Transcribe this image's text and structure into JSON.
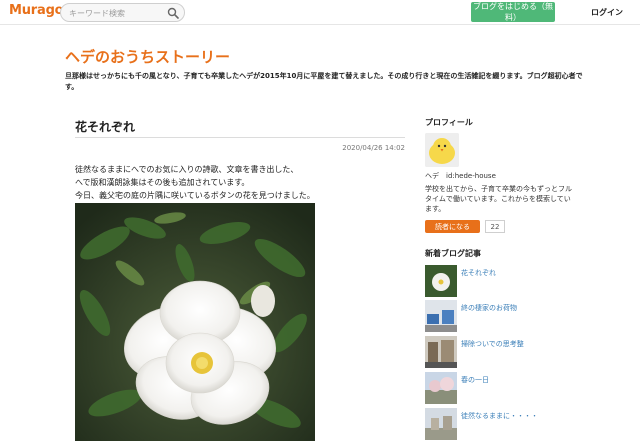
{
  "header": {
    "logo": "Muragon",
    "search_placeholder": "キーワード検索",
    "start_button": "ブログをはじめる（無料）",
    "login": "ログイン"
  },
  "blog": {
    "title": "ヘデのおうちストーリー",
    "description": "旦那様はせっかちにも千の風となり、子育ても卒業したヘデが2015年10月に平屋を建て替えました。その成り行きと現在の生活雑記を綴ります。ブログ超初心者です。"
  },
  "post": {
    "title": "花それぞれ",
    "date": "2020/04/26 14:02",
    "lines": [
      "徒然なるままにへでのお気に入りの詩歌、文章を書き出した、",
      "へで版和漢朗詠集はその後も追加されています。",
      "今日、義父宅の庭の片隅に咲いているボタンの花を見つけました。"
    ]
  },
  "sidebar": {
    "profile_heading": "プロフィール",
    "profile_name": "ヘデ　id:hede-house",
    "profile_text": "学校を出てから、子育て卒業の今もずっとフルタイムで働いています。これからを模索しています。",
    "reader_button": "読者になる",
    "reader_count": "22",
    "recent_heading": "新着ブログ記事",
    "recent": [
      {
        "label": "花それぞれ"
      },
      {
        "label": "終の棲家のお荷物"
      },
      {
        "label": "掃除ついでの思考整"
      },
      {
        "label": "春の一日"
      },
      {
        "label": "徒然なるままに・・・・"
      }
    ]
  },
  "colors": {
    "accent": "#e8701a",
    "start_button": "#4fb878",
    "link": "#3b7fb8"
  }
}
